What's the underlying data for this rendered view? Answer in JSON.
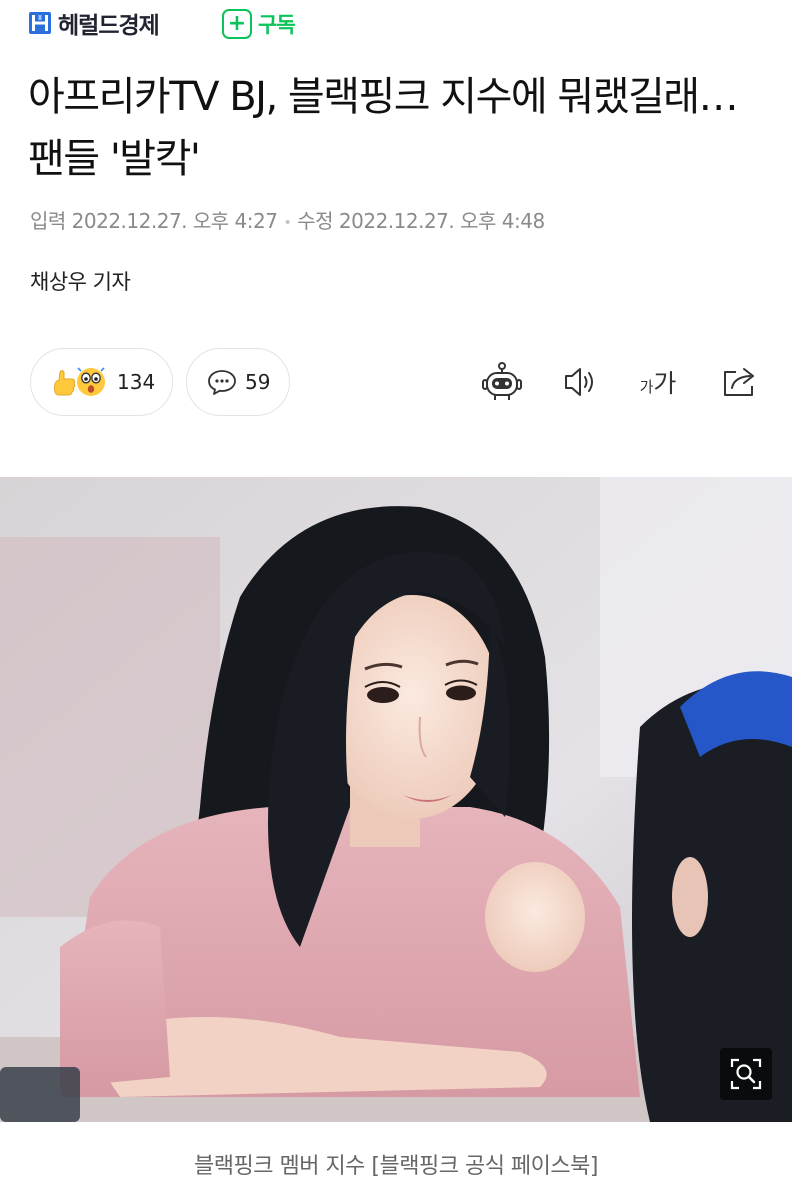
{
  "header": {
    "press_name": "헤럴드경제",
    "subscribe_label": "구독"
  },
  "article": {
    "headline": "아프리카TV BJ, 블랙핑크 지수에 뭐랬길래…팬들 '발칵'",
    "published": "입력 2022.12.27. 오후 4:27",
    "modified": "수정 2022.12.27. 오후 4:48",
    "reporter": "채상우 기자"
  },
  "actions": {
    "reactions_count": "134",
    "comments_count": "59",
    "font_size_label": "가",
    "font_size_small": "가"
  },
  "image": {
    "caption": "블랙핑크 멤버 지수 [블랙핑크 공식 페이스북]"
  },
  "colors": {
    "subscribe": "#08c45a",
    "logo_blue": "#2a6fdc"
  }
}
